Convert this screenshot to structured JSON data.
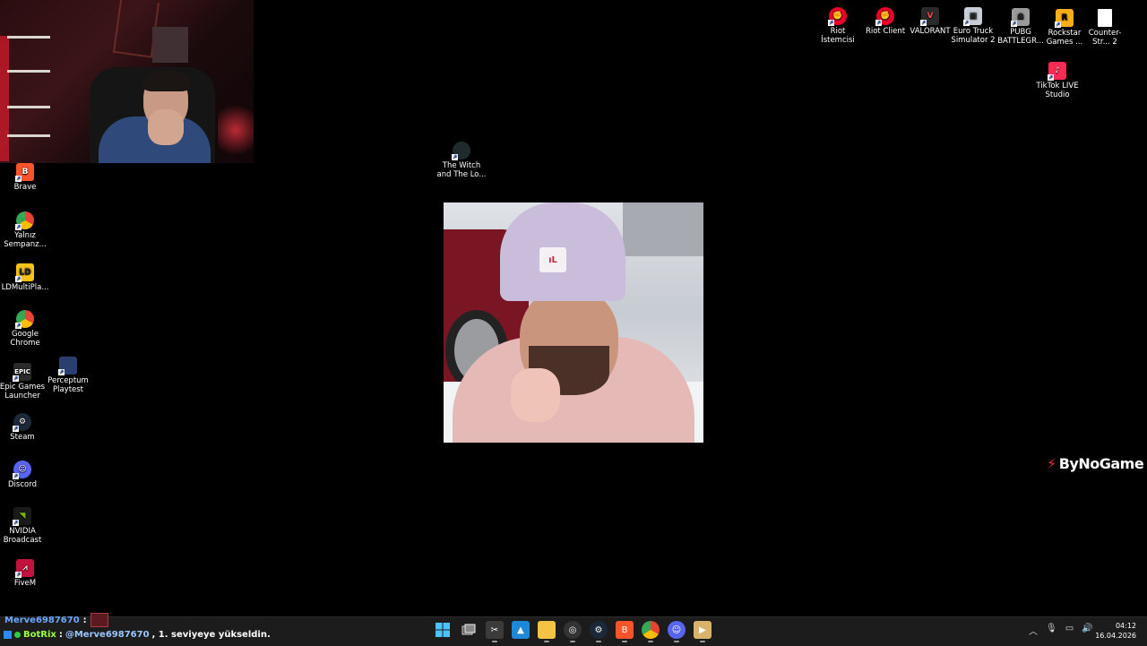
{
  "desktop": {
    "left_icons": [
      {
        "label": "Brave",
        "icon": "brave-icon",
        "color": "#fb542b"
      },
      {
        "label": "Yalnız Sempanz...",
        "icon": "chrome-icon",
        "color": "#4285f4"
      },
      {
        "label": "LDMultiPla...",
        "icon": "ldplayer-icon",
        "color": "#f7c31b"
      },
      {
        "label": "Google Chrome",
        "icon": "chrome-icon",
        "color": "#4285f4"
      },
      {
        "label": "Epic Games Launcher",
        "icon": "epic-games-icon",
        "color": "#2a2a2a"
      },
      {
        "label": "Steam",
        "icon": "steam-icon",
        "color": "#1b2838"
      },
      {
        "label": "Discord",
        "icon": "discord-icon",
        "color": "#5865f2"
      },
      {
        "label": "NVIDIA Broadcast",
        "icon": "nvidia-icon",
        "color": "#76b900"
      },
      {
        "label": "FiveM",
        "icon": "fivem-icon",
        "color": "#f40552"
      }
    ],
    "perceptum": {
      "label": "Perceptum Playtest",
      "icon": "perceptum-icon",
      "color": "#2b3f6e"
    },
    "witch": {
      "label": "The Witch and The Lo...",
      "icon": "witch-game-icon",
      "color": "#2d3a3e"
    },
    "top_icons": [
      {
        "label": "Riot İstemcisi",
        "icon": "riot-icon",
        "color": "#eb0029"
      },
      {
        "label": "Riot Client",
        "icon": "riot-icon",
        "color": "#eb0029"
      },
      {
        "label": "VALORANT",
        "icon": "valorant-icon",
        "color": "#2a2a2a"
      },
      {
        "label": "Euro Truck Simulator 2",
        "icon": "ets2-icon",
        "color": "#c9ced6"
      },
      {
        "label": "PUBG BATTLEGR...",
        "icon": "pubg-icon",
        "color": "#b0b0b0"
      },
      {
        "label": "Rockstar Games ...",
        "icon": "rockstar-icon",
        "color": "#fcaf17"
      },
      {
        "label": "Counter-Str... 2",
        "icon": "file-icon",
        "color": "#ffffff"
      }
    ],
    "tiktok": {
      "label": "TikTok LIVE Studio",
      "icon": "tiktok-icon",
      "color": "#fe2c55"
    }
  },
  "brand": {
    "logo": "ByNoGame"
  },
  "chat": {
    "line1_user": "Merve6987670",
    "line1_colon": ":",
    "line2_bot": "BotRix",
    "line2_colon": ":",
    "line2_mention": "@Merve6987670",
    "line2_text": ", 1. seviyeye yükseldin."
  },
  "taskbar": {
    "icons": [
      "windows-start-icon",
      "task-view-icon",
      "snipping-icon",
      "photos-icon",
      "file-explorer-icon",
      "obs-icon",
      "steam-icon",
      "brave-icon",
      "chrome-icon",
      "discord-icon",
      "media-player-icon"
    ],
    "clock_time": "04:12",
    "clock_date": "16.04.2026"
  }
}
